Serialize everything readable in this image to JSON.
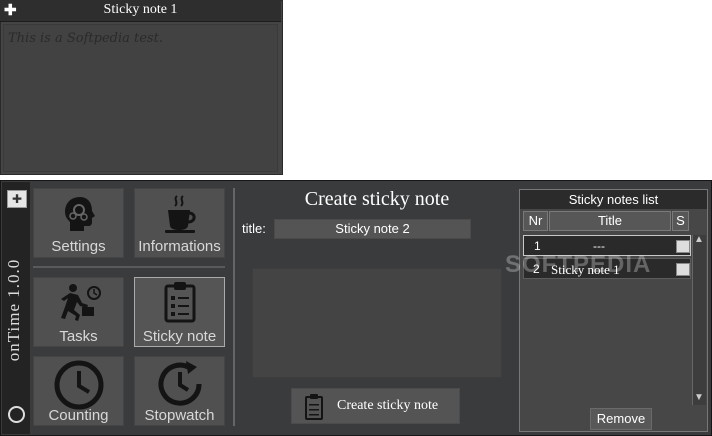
{
  "note_window": {
    "title": "Sticky note 1",
    "pin_icon": "pin-icon",
    "close_icon": "close-icon",
    "body_text": "This is a Softpedia test."
  },
  "sidebar": {
    "app_label": "onTime 1.0.0",
    "pin_icon": "pin-icon",
    "clock_icon": "clock-icon"
  },
  "tiles": {
    "settings": "Settings",
    "informations": "Informations",
    "tasks": "Tasks",
    "sticky_note": "Sticky note",
    "counting": "Counting",
    "stopwatch": "Stopwatch"
  },
  "create_panel": {
    "heading": "Create sticky note",
    "title_label": "title:",
    "title_value": "Sticky note 2",
    "create_button": "Create sticky note"
  },
  "list_panel": {
    "heading": "Sticky notes list",
    "columns": [
      "Nr",
      "Title",
      "S"
    ],
    "rows": [
      {
        "nr": "1",
        "title": "---"
      },
      {
        "nr": "2",
        "title": "Sticky note 1"
      }
    ],
    "remove_button": "Remove"
  },
  "watermark": "SOFTPEDIA",
  "colors": {
    "window_bg": "#3a3b3c",
    "tile_bg": "#505050",
    "titlebar": "#2e2e2e"
  }
}
